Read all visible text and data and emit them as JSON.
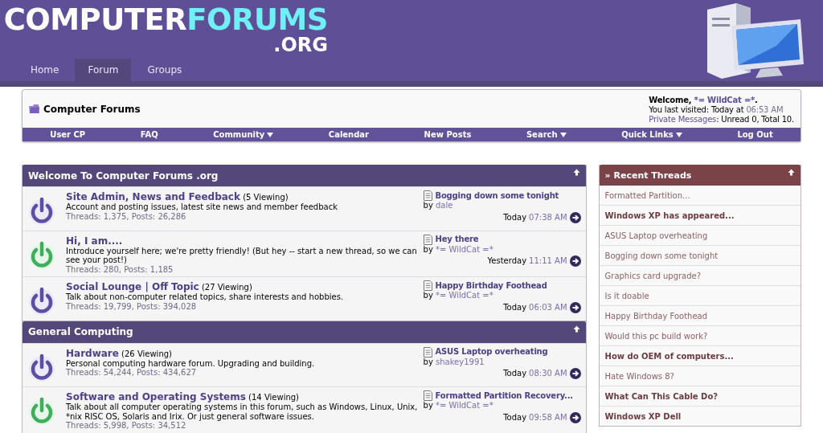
{
  "site": {
    "logo": {
      "word_1": "COMPUTER",
      "word_2": "FORUMS",
      "suffix": ".ORG"
    },
    "tabs": [
      {
        "label": "Home",
        "selected": false
      },
      {
        "label": "Forum",
        "selected": true
      },
      {
        "label": "Groups",
        "selected": false
      }
    ]
  },
  "navbox": {
    "title": "Computer Forums",
    "welcome": {
      "greeting": "Welcome,",
      "username": "*= WildCat =*",
      "end": ".",
      "last_visited_label": "You last visited: Today at",
      "last_visited_time": "06:53 AM",
      "messages_link": "Private Messages",
      "messages_text": ": Unread 0, Total 10."
    },
    "links": [
      {
        "label": "User CP",
        "has_menu": false
      },
      {
        "label": "FAQ",
        "has_menu": false
      },
      {
        "label": "Community",
        "has_menu": true
      },
      {
        "label": "Calendar",
        "has_menu": false
      },
      {
        "label": "New Posts",
        "has_menu": false
      },
      {
        "label": "Search",
        "has_menu": true
      },
      {
        "label": "Quick Links",
        "has_menu": true
      },
      {
        "label": "Log Out",
        "has_menu": false
      }
    ]
  },
  "categories": [
    {
      "title": "Welcome To Computer Forums .org",
      "forums": [
        {
          "title": "Site Admin, News and Feedback",
          "viewing": "(5 Viewing)",
          "description": "Account and posting issues, latest site news and member feedback",
          "stats": "Threads: 1,375, Posts: 26,286",
          "new_posts": false,
          "last_post": {
            "title": "Bogging down some tonight",
            "by": "by",
            "user": "dale",
            "day": "Today",
            "time": "07:38 AM"
          }
        },
        {
          "title": "Hi, I am....",
          "description": "Introduce yourself here; we're pretty friendly! (But hey -- start a new thread, so we can see your post!)",
          "stats": "Threads: 280, Posts: 1,185",
          "new_posts": true,
          "last_post": {
            "title": "Hey there",
            "by": "by",
            "user": "*= WildCat =*",
            "day": "Yesterday",
            "time": "11:11 AM"
          }
        },
        {
          "title": "Social Lounge | Off Topic",
          "viewing": "(27 Viewing)",
          "description": "Talk about non-computer related topics, share interests and hobbies.",
          "stats": "Threads: 19,799, Posts: 394,028",
          "new_posts": false,
          "last_post": {
            "title": "Happy Birthday Foothead",
            "by": "by",
            "user": "*= WildCat =*",
            "day": "Today",
            "time": "06:03 AM"
          }
        }
      ]
    },
    {
      "title": "General Computing",
      "forums": [
        {
          "title": "Hardware",
          "viewing": "(26 Viewing)",
          "description": "Personal computing hardware forum. Upgrading and building.",
          "stats": "Threads: 54,244, Posts: 434,627",
          "new_posts": false,
          "last_post": {
            "title": "ASUS Laptop overheating",
            "by": "by",
            "user": "shakey1991",
            "day": "Today",
            "time": "08:30 AM"
          }
        },
        {
          "title": "Software and Operating Systems",
          "viewing": "(14 Viewing)",
          "description": "Talk about all computer operating systems in this forum, such as Windows, Linux, Unix, *nix RISC OS, Solaris and Irix. Or just general software issues.",
          "stats": "Threads: 5,998, Posts: 34,512",
          "new_posts": true,
          "last_post": {
            "title": "Formatted Partition Recovery...",
            "by": "by",
            "user": "*= WildCat =*",
            "day": "Today",
            "time": "09:58 AM"
          }
        }
      ]
    }
  ],
  "recent_threads": {
    "title": "» Recent Threads",
    "items": [
      {
        "title": "Formatted Partition...",
        "unread": false
      },
      {
        "title": "Windows XP has appeared...",
        "unread": true
      },
      {
        "title": "ASUS Laptop overheating",
        "unread": false
      },
      {
        "title": "Bogging down some tonight",
        "unread": false
      },
      {
        "title": "Graphics card upgrade?",
        "unread": false
      },
      {
        "title": "Is it doable",
        "unread": false
      },
      {
        "title": "Happy Birthday Foothead",
        "unread": false
      },
      {
        "title": "Would this pc build work?",
        "unread": false
      },
      {
        "title": "How do OEM of computers...",
        "unread": true
      },
      {
        "title": "Hate Windows 8?",
        "unread": false
      },
      {
        "title": "What Can This Cable Do?",
        "unread": true
      },
      {
        "title": "Windows XP Dell",
        "unread": true
      }
    ]
  }
}
